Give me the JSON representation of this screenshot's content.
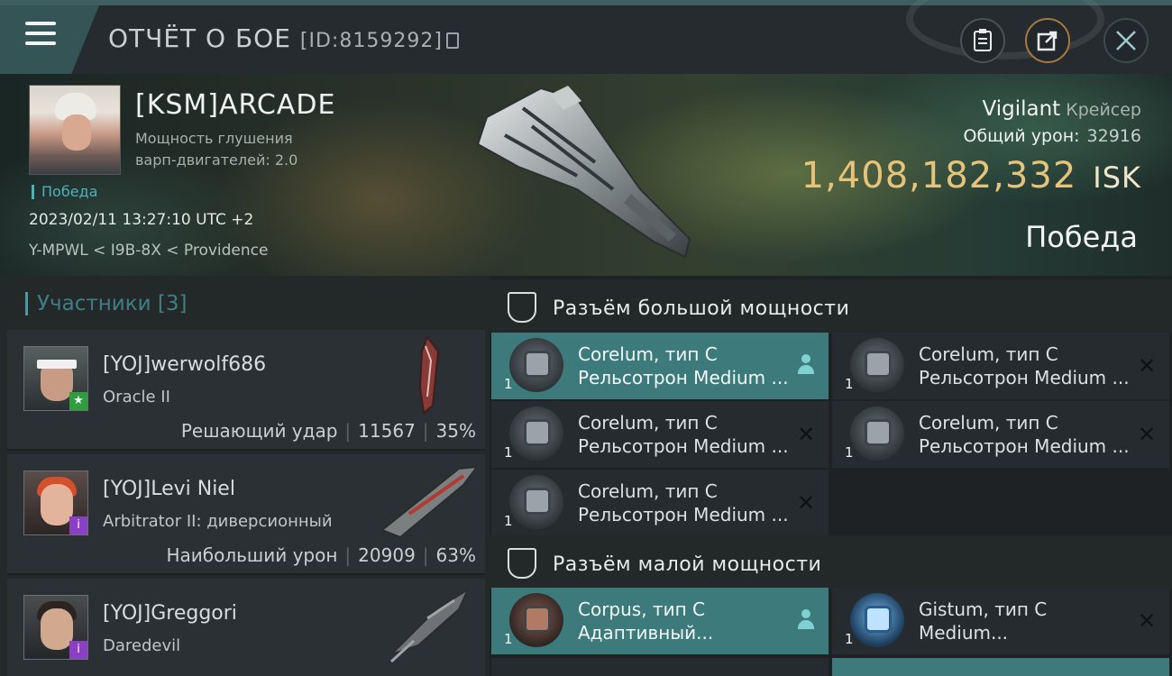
{
  "header": {
    "title": "ОТЧЁТ О БОЕ",
    "battle_id": "[ID:8159292]",
    "buttons": [
      "clipboard-icon",
      "share-icon",
      "close-icon"
    ]
  },
  "hero": {
    "pilot_name": "[KSM]ARCADE",
    "pilot_info": "Мощность глушения варп-двигателей: 2.0",
    "result_tag": "Победа",
    "timestamp": "2023/02/11 13:27:10 UTC +2",
    "location": "Y-MPWL < I9B-8X < Providence",
    "ship_name": "Vigilant",
    "ship_class": "Крейсер",
    "total_damage_label": "Общий урон:",
    "total_damage": "32916",
    "isk_value": "1,408,182,332",
    "isk_unit": "ISK",
    "result": "Победа"
  },
  "participants": {
    "header": "Участники [3]",
    "items": [
      {
        "name": "[YOJ]werwolf686",
        "ship": "Oracle II",
        "stat_label": "Решающий удар",
        "damage": "11567",
        "percent": "35%",
        "badge": "★",
        "badge_color": "#2e9e3e"
      },
      {
        "name": "[YOJ]Levi Niel",
        "ship": "Arbitrator II: диверсионный",
        "stat_label": "Наибольший урон",
        "damage": "20909",
        "percent": "63%",
        "badge": "i",
        "badge_color": "#8b3fc4"
      },
      {
        "name": "[YOJ]Greggori",
        "ship": "Daredevil",
        "stat_label": "",
        "damage": "",
        "percent": "",
        "badge": "i",
        "badge_color": "#8b3fc4"
      }
    ]
  },
  "high_slots": {
    "title": "Разъём большой мощности",
    "modules": [
      {
        "qty": "1",
        "name": "Corelum, тип C",
        "desc": "Рельсотрон Medium ...",
        "status": "pilot"
      },
      {
        "qty": "1",
        "name": "Corelum, тип C",
        "desc": "Рельсотрон Medium ...",
        "status": "destroyed"
      },
      {
        "qty": "1",
        "name": "Corelum, тип C",
        "desc": "Рельсотрон Medium ...",
        "status": "destroyed"
      },
      {
        "qty": "1",
        "name": "Corelum, тип C",
        "desc": "Рельсотрон Medium ...",
        "status": "destroyed"
      },
      {
        "qty": "1",
        "name": "Corelum, тип C",
        "desc": "Рельсотрон Medium ...",
        "status": "destroyed"
      }
    ]
  },
  "low_slots": {
    "title": "Разъём малой мощности",
    "modules": [
      {
        "qty": "1",
        "name": "Corpus, тип C",
        "desc": "Адаптивный...",
        "status": "pilot"
      },
      {
        "qty": "1",
        "name": "Gistum, тип C",
        "desc": "Medium...",
        "status": "destroyed"
      }
    ]
  },
  "colors": {
    "accent_teal": "#4cb4b9",
    "isk_gold": "#e6c37a",
    "highlight_row": "#3c7a7c"
  }
}
